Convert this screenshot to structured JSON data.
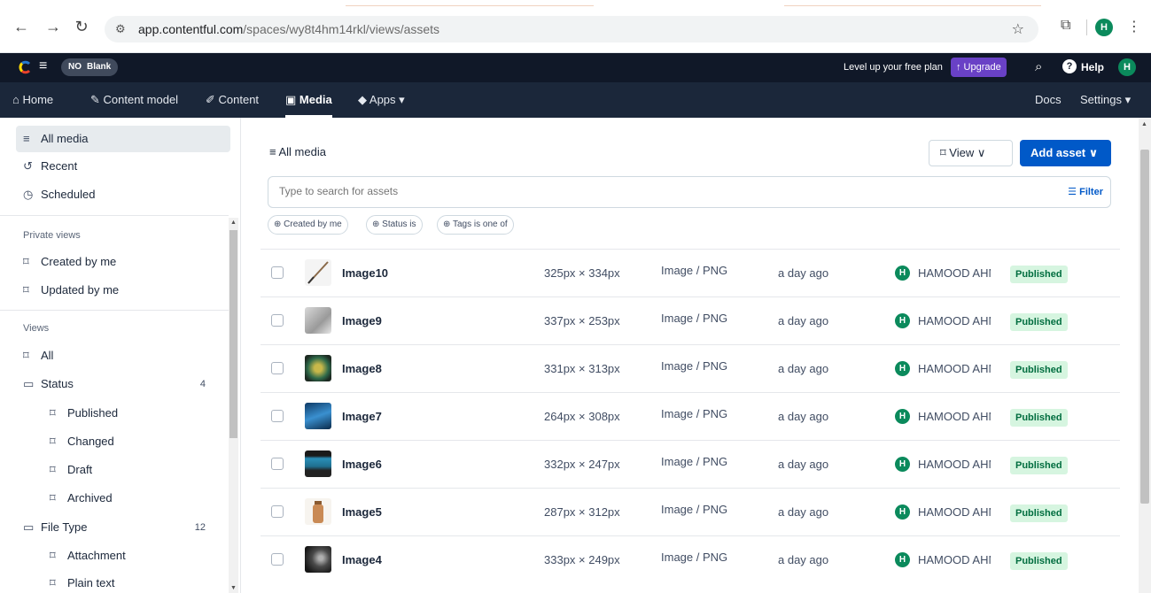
{
  "browser": {
    "url_host": "app.contentful.com",
    "url_path": "/spaces/wy8t4hm14rkl/views/assets",
    "profile_initial": "H"
  },
  "topbar": {
    "space_badge": "NO",
    "space_name": "Blank",
    "free_plan_text": "Level up your free plan",
    "upgrade_label": "↑ Upgrade",
    "help_label": "Help",
    "avatar_initial": "H"
  },
  "nav": {
    "home": "Home",
    "content_model": "Content model",
    "content": "Content",
    "media": "Media",
    "apps": "Apps ▾",
    "docs": "Docs",
    "settings": "Settings ▾"
  },
  "sidebar": {
    "all_media": "All media",
    "recent": "Recent",
    "scheduled": "Scheduled",
    "private_views_heading": "Private views",
    "created_by_me": "Created by me",
    "updated_by_me": "Updated by me",
    "views_heading": "Views",
    "all": "All",
    "status": "Status",
    "status_count": "4",
    "published": "Published",
    "changed": "Changed",
    "draft": "Draft",
    "archived": "Archived",
    "file_type": "File Type",
    "file_type_count": "12",
    "attachment": "Attachment",
    "plain_text": "Plain text"
  },
  "main": {
    "title": "All media",
    "view_label": "View ∨",
    "add_asset_label": "Add asset ∨",
    "search_placeholder": "Type to search for assets",
    "filter_label": "Filter",
    "chips": [
      "⊕ Created by me",
      "⊕ Status is",
      "⊕ Tags is one of"
    ]
  },
  "assets": [
    {
      "name": "Image10",
      "dims": "325px × 334px",
      "type": "Image / PNG",
      "updated": "a day ago",
      "author": "HAMOOD AHMED",
      "status": "Published"
    },
    {
      "name": "Image9",
      "dims": "337px × 253px",
      "type": "Image / PNG",
      "updated": "a day ago",
      "author": "HAMOOD AHMED",
      "status": "Published"
    },
    {
      "name": "Image8",
      "dims": "331px × 313px",
      "type": "Image / PNG",
      "updated": "a day ago",
      "author": "HAMOOD AHMED",
      "status": "Published"
    },
    {
      "name": "Image7",
      "dims": "264px × 308px",
      "type": "Image / PNG",
      "updated": "a day ago",
      "author": "HAMOOD AHMED",
      "status": "Published"
    },
    {
      "name": "Image6",
      "dims": "332px × 247px",
      "type": "Image / PNG",
      "updated": "a day ago",
      "author": "HAMOOD AHMED",
      "status": "Published"
    },
    {
      "name": "Image5",
      "dims": "287px × 312px",
      "type": "Image / PNG",
      "updated": "a day ago",
      "author": "HAMOOD AHMED",
      "status": "Published"
    },
    {
      "name": "Image4",
      "dims": "333px × 249px",
      "type": "Image / PNG",
      "updated": "a day ago",
      "author": "HAMOOD AHMED",
      "status": "Published"
    }
  ],
  "colors": {
    "accent": "#0059c8",
    "topbar": "#101828",
    "navbar": "#1b273a",
    "upgrade": "#6941c6",
    "avatar": "#0b8a5c",
    "published_bg": "#d6f5e0"
  }
}
